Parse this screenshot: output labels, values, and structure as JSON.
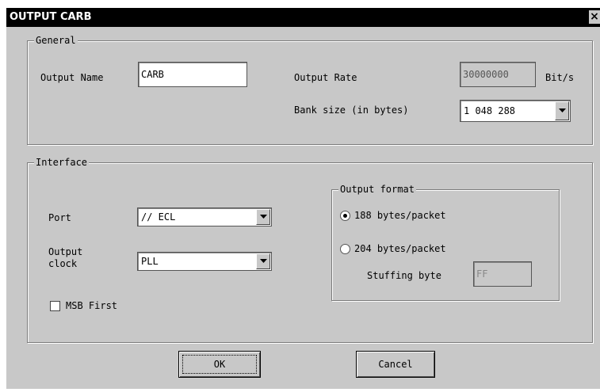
{
  "window": {
    "title": "OUTPUT CARB",
    "close_glyph": "×"
  },
  "general": {
    "legend": "General",
    "output_name_label": "Output Name",
    "output_name_value": "CARB",
    "output_rate_label": "Output Rate",
    "output_rate_value": "30000000",
    "output_rate_unit": "Bit/s",
    "bank_size_label": "Bank size (in bytes)",
    "bank_size_value": "1 048 288"
  },
  "interface": {
    "legend": "Interface",
    "port_label": "Port",
    "port_value": "// ECL",
    "output_clock_label_line1": "Output",
    "output_clock_label_line2": "clock",
    "output_clock_value": "PLL",
    "msb_first_label": "MSB First",
    "msb_first_checked": false
  },
  "output_format": {
    "legend": "Output format",
    "option_188_label": "188 bytes/packet",
    "option_204_label": "204 bytes/packet",
    "selected": "188",
    "stuffing_label": "Stuffing byte",
    "stuffing_value": "FF"
  },
  "buttons": {
    "ok_label": "OK",
    "cancel_label": "Cancel"
  },
  "icons": {
    "dropdown": "chevron-down-icon",
    "close": "close-icon"
  }
}
